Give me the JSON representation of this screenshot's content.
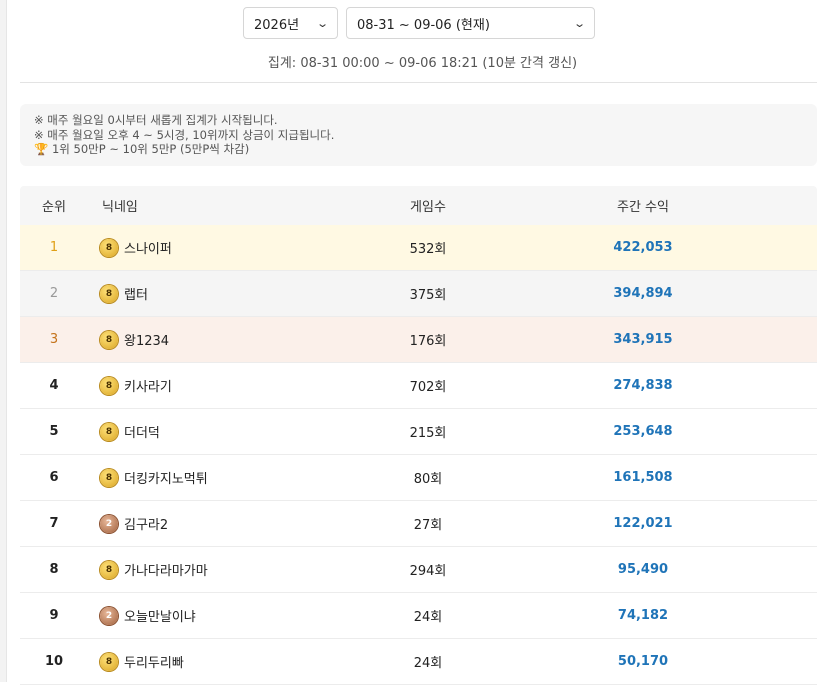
{
  "filters": {
    "year": "2026년",
    "week": "08-31 ~ 09-06 (현재)"
  },
  "period": "집계: 08-31 00:00 ~ 09-06 18:21 (10분 간격 갱신)",
  "notice": {
    "line1": "※ 매주 월요일 0시부터 새롭게 집계가 시작됩니다.",
    "line2": "※ 매주 월요일 오후 4 ~ 5시경, 10위까지 상금이 지급됩니다.",
    "line3_icon": "trophy-icon",
    "line3": "1위 50만P ~ 10위 5만P (5만P씩 차감)"
  },
  "table": {
    "headers": {
      "rank": "순위",
      "nickname": "닉네임",
      "games": "게임수",
      "earnings": "주간 수익"
    },
    "rows": [
      {
        "rank": "1",
        "level": "8",
        "nickname": "스나이퍼",
        "games": "532회",
        "earnings": "422,053"
      },
      {
        "rank": "2",
        "level": "8",
        "nickname": "랩터",
        "games": "375회",
        "earnings": "394,894"
      },
      {
        "rank": "3",
        "level": "8",
        "nickname": "왕1234",
        "games": "176회",
        "earnings": "343,915"
      },
      {
        "rank": "4",
        "level": "8",
        "nickname": "키사라기",
        "games": "702회",
        "earnings": "274,838"
      },
      {
        "rank": "5",
        "level": "8",
        "nickname": "더더덕",
        "games": "215회",
        "earnings": "253,648"
      },
      {
        "rank": "6",
        "level": "8",
        "nickname": "더킹카지노먹튀",
        "games": "80회",
        "earnings": "161,508"
      },
      {
        "rank": "7",
        "level": "2",
        "nickname": "김구라2",
        "games": "27회",
        "earnings": "122,021"
      },
      {
        "rank": "8",
        "level": "8",
        "nickname": "가나다라마가마",
        "games": "294회",
        "earnings": "95,490"
      },
      {
        "rank": "9",
        "level": "2",
        "nickname": "오늘만날이냐",
        "games": "24회",
        "earnings": "74,182"
      },
      {
        "rank": "10",
        "level": "8",
        "nickname": "두리두리빠",
        "games": "24회",
        "earnings": "50,170"
      }
    ]
  },
  "colors": {
    "earnings": "#1f74b8",
    "gold": "#e0a017",
    "silver": "#999999",
    "bronze": "#c4731b"
  }
}
